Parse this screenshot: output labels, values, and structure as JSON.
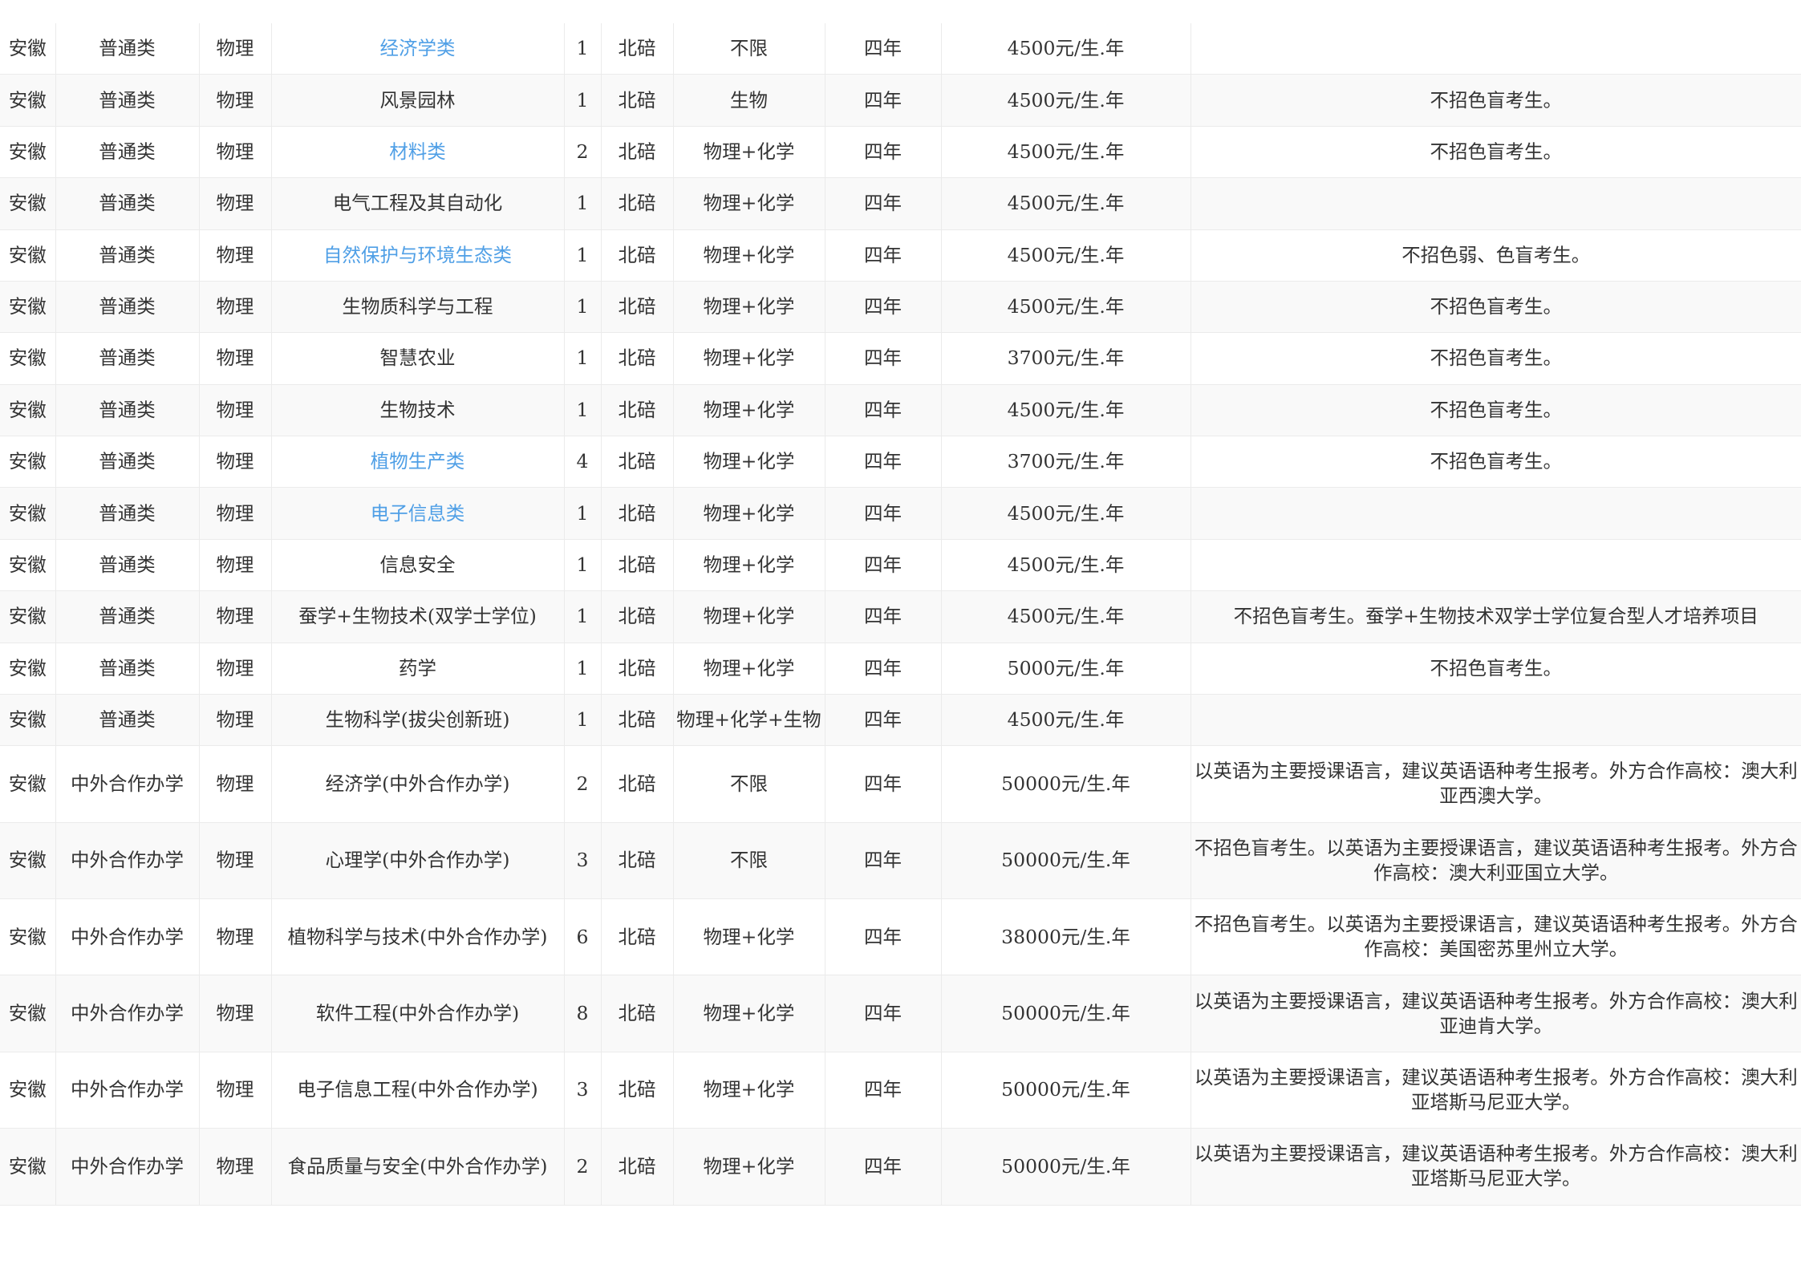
{
  "colors": {
    "link": "#4f9fe6",
    "text": "#333333",
    "stripe": "#f9f9f9",
    "border": "#ebebeb"
  },
  "table": {
    "rows": [
      {
        "province": "安徽",
        "type": "普通类",
        "subject": "物理",
        "major": "经济学类",
        "is_link": true,
        "count": "1",
        "campus": "北碚",
        "requirement": "不限",
        "duration": "四年",
        "fee": "4500元/生.年",
        "notes": ""
      },
      {
        "province": "安徽",
        "type": "普通类",
        "subject": "物理",
        "major": "风景园林",
        "is_link": false,
        "count": "1",
        "campus": "北碚",
        "requirement": "生物",
        "duration": "四年",
        "fee": "4500元/生.年",
        "notes": "不招色盲考生。"
      },
      {
        "province": "安徽",
        "type": "普通类",
        "subject": "物理",
        "major": "材料类",
        "is_link": true,
        "count": "2",
        "campus": "北碚",
        "requirement": "物理+化学",
        "duration": "四年",
        "fee": "4500元/生.年",
        "notes": "不招色盲考生。"
      },
      {
        "province": "安徽",
        "type": "普通类",
        "subject": "物理",
        "major": "电气工程及其自动化",
        "is_link": false,
        "count": "1",
        "campus": "北碚",
        "requirement": "物理+化学",
        "duration": "四年",
        "fee": "4500元/生.年",
        "notes": ""
      },
      {
        "province": "安徽",
        "type": "普通类",
        "subject": "物理",
        "major": "自然保护与环境生态类",
        "is_link": true,
        "count": "1",
        "campus": "北碚",
        "requirement": "物理+化学",
        "duration": "四年",
        "fee": "4500元/生.年",
        "notes": "不招色弱、色盲考生。"
      },
      {
        "province": "安徽",
        "type": "普通类",
        "subject": "物理",
        "major": "生物质科学与工程",
        "is_link": false,
        "count": "1",
        "campus": "北碚",
        "requirement": "物理+化学",
        "duration": "四年",
        "fee": "4500元/生.年",
        "notes": "不招色盲考生。"
      },
      {
        "province": "安徽",
        "type": "普通类",
        "subject": "物理",
        "major": "智慧农业",
        "is_link": false,
        "count": "1",
        "campus": "北碚",
        "requirement": "物理+化学",
        "duration": "四年",
        "fee": "3700元/生.年",
        "notes": "不招色盲考生。"
      },
      {
        "province": "安徽",
        "type": "普通类",
        "subject": "物理",
        "major": "生物技术",
        "is_link": false,
        "count": "1",
        "campus": "北碚",
        "requirement": "物理+化学",
        "duration": "四年",
        "fee": "4500元/生.年",
        "notes": "不招色盲考生。"
      },
      {
        "province": "安徽",
        "type": "普通类",
        "subject": "物理",
        "major": "植物生产类",
        "is_link": true,
        "count": "4",
        "campus": "北碚",
        "requirement": "物理+化学",
        "duration": "四年",
        "fee": "3700元/生.年",
        "notes": "不招色盲考生。"
      },
      {
        "province": "安徽",
        "type": "普通类",
        "subject": "物理",
        "major": "电子信息类",
        "is_link": true,
        "count": "1",
        "campus": "北碚",
        "requirement": "物理+化学",
        "duration": "四年",
        "fee": "4500元/生.年",
        "notes": ""
      },
      {
        "province": "安徽",
        "type": "普通类",
        "subject": "物理",
        "major": "信息安全",
        "is_link": false,
        "count": "1",
        "campus": "北碚",
        "requirement": "物理+化学",
        "duration": "四年",
        "fee": "4500元/生.年",
        "notes": ""
      },
      {
        "province": "安徽",
        "type": "普通类",
        "subject": "物理",
        "major": "蚕学+生物技术(双学士学位)",
        "is_link": false,
        "count": "1",
        "campus": "北碚",
        "requirement": "物理+化学",
        "duration": "四年",
        "fee": "4500元/生.年",
        "notes": "不招色盲考生。蚕学+生物技术双学士学位复合型人才培养项目"
      },
      {
        "province": "安徽",
        "type": "普通类",
        "subject": "物理",
        "major": "药学",
        "is_link": false,
        "count": "1",
        "campus": "北碚",
        "requirement": "物理+化学",
        "duration": "四年",
        "fee": "5000元/生.年",
        "notes": "不招色盲考生。"
      },
      {
        "province": "安徽",
        "type": "普通类",
        "subject": "物理",
        "major": "生物科学(拔尖创新班)",
        "is_link": false,
        "count": "1",
        "campus": "北碚",
        "requirement": "物理+化学+生物",
        "duration": "四年",
        "fee": "4500元/生.年",
        "notes": ""
      },
      {
        "province": "安徽",
        "type": "中外合作办学",
        "subject": "物理",
        "major": "经济学(中外合作办学)",
        "is_link": false,
        "count": "2",
        "campus": "北碚",
        "requirement": "不限",
        "duration": "四年",
        "fee": "50000元/生.年",
        "notes": "以英语为主要授课语言，建议英语语种考生报考。外方合作高校：澳大利亚西澳大学。"
      },
      {
        "province": "安徽",
        "type": "中外合作办学",
        "subject": "物理",
        "major": "心理学(中外合作办学)",
        "is_link": false,
        "count": "3",
        "campus": "北碚",
        "requirement": "不限",
        "duration": "四年",
        "fee": "50000元/生.年",
        "notes": "不招色盲考生。以英语为主要授课语言，建议英语语种考生报考。外方合作高校：澳大利亚国立大学。"
      },
      {
        "province": "安徽",
        "type": "中外合作办学",
        "subject": "物理",
        "major": "植物科学与技术(中外合作办学)",
        "is_link": false,
        "count": "6",
        "campus": "北碚",
        "requirement": "物理+化学",
        "duration": "四年",
        "fee": "38000元/生.年",
        "notes": "不招色盲考生。以英语为主要授课语言，建议英语语种考生报考。外方合作高校：美国密苏里州立大学。"
      },
      {
        "province": "安徽",
        "type": "中外合作办学",
        "subject": "物理",
        "major": "软件工程(中外合作办学)",
        "is_link": false,
        "count": "8",
        "campus": "北碚",
        "requirement": "物理+化学",
        "duration": "四年",
        "fee": "50000元/生.年",
        "notes": "以英语为主要授课语言，建议英语语种考生报考。外方合作高校：澳大利亚迪肯大学。"
      },
      {
        "province": "安徽",
        "type": "中外合作办学",
        "subject": "物理",
        "major": "电子信息工程(中外合作办学)",
        "is_link": false,
        "count": "3",
        "campus": "北碚",
        "requirement": "物理+化学",
        "duration": "四年",
        "fee": "50000元/生.年",
        "notes": "以英语为主要授课语言，建议英语语种考生报考。外方合作高校：澳大利亚塔斯马尼亚大学。"
      },
      {
        "province": "安徽",
        "type": "中外合作办学",
        "subject": "物理",
        "major": "食品质量与安全(中外合作办学)",
        "is_link": false,
        "count": "2",
        "campus": "北碚",
        "requirement": "物理+化学",
        "duration": "四年",
        "fee": "50000元/生.年",
        "notes": "以英语为主要授课语言，建议英语语种考生报考。外方合作高校：澳大利亚塔斯马尼亚大学。"
      }
    ]
  }
}
